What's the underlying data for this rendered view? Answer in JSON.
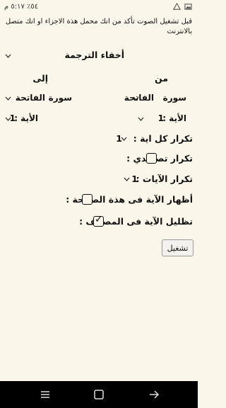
{
  "status_bar": {
    "time": "٥:١٧ م",
    "battery": "٥٤٪",
    "icons": [
      "battery-icon",
      "signal-icon",
      "wifi-icon",
      "notification-icon",
      "gallery-icon"
    ]
  },
  "notice": "قبل تشغيل الصوت تأكد من انك محمل هذة الاجزاء او انك متصل بالانترنت",
  "translation_toggle": "أخفاء الترجمة",
  "from_label": "من",
  "to_label": "إلى",
  "from": {
    "surah_label": "سورة",
    "surah_value": "الفاتحة",
    "ayah_label": "الأية :",
    "ayah_value": "1"
  },
  "to": {
    "surah_label": "سورة",
    "surah_value": "الفاتحة",
    "ayah_label": "الأية :",
    "ayah_value": "1"
  },
  "repeat_each": {
    "label": "تكرار كل اية :",
    "value": "1"
  },
  "repeat_ascending": {
    "label": "تكرار تصاعدي :",
    "checked": false
  },
  "repeat_ayat": {
    "label": "تكرار الآيات :",
    "value": "1"
  },
  "show_on_page": {
    "label": "أظهار الآية فى هذة الصفحة :",
    "checked": false
  },
  "highlight_mushaf": {
    "label": "تظليل الآية فى المصحف :",
    "checked": true
  },
  "play_button": "تشغيل",
  "navbar": {
    "icons": [
      "recents-icon",
      "home-icon",
      "back-icon"
    ]
  }
}
